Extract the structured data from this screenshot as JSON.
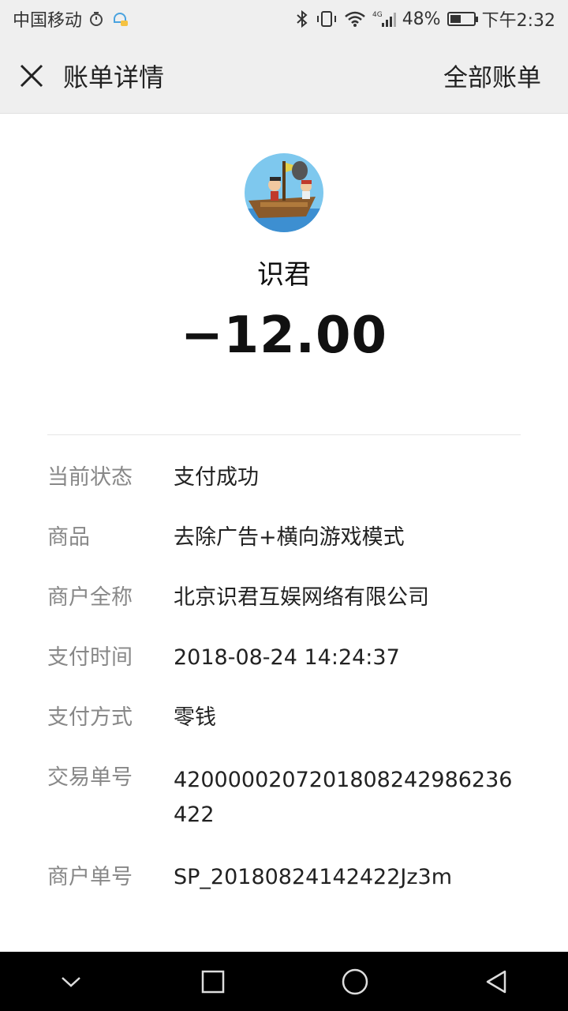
{
  "status_bar": {
    "carrier": "中国移动",
    "battery": "48%",
    "battery_level": 0.48,
    "time": "下午2:32",
    "icons": [
      "alarm-icon",
      "notification-icon",
      "bluetooth-icon",
      "vibrate-icon",
      "wifi-icon",
      "signal-icon",
      "battery-icon"
    ]
  },
  "header": {
    "title": "账单详情",
    "right_link": "全部账单"
  },
  "transaction": {
    "merchant_name": "识君",
    "amount": "−12.00"
  },
  "details": [
    {
      "label": "当前状态",
      "value": "支付成功"
    },
    {
      "label": "商品",
      "value": "去除广告+横向游戏模式"
    },
    {
      "label": "商户全称",
      "value": "北京识君互娱网络有限公司"
    },
    {
      "label": "支付时间",
      "value": "2018-08-24 14:24:37"
    },
    {
      "label": "支付方式",
      "value": "零钱"
    },
    {
      "label": "交易单号",
      "value": "4200000207201808242986236422"
    },
    {
      "label": "商户单号",
      "value": "SP_20180824142422Jz3m"
    }
  ],
  "nav": {
    "icons": [
      "chevron-down-icon",
      "square-icon",
      "circle-icon",
      "triangle-back-icon"
    ]
  }
}
